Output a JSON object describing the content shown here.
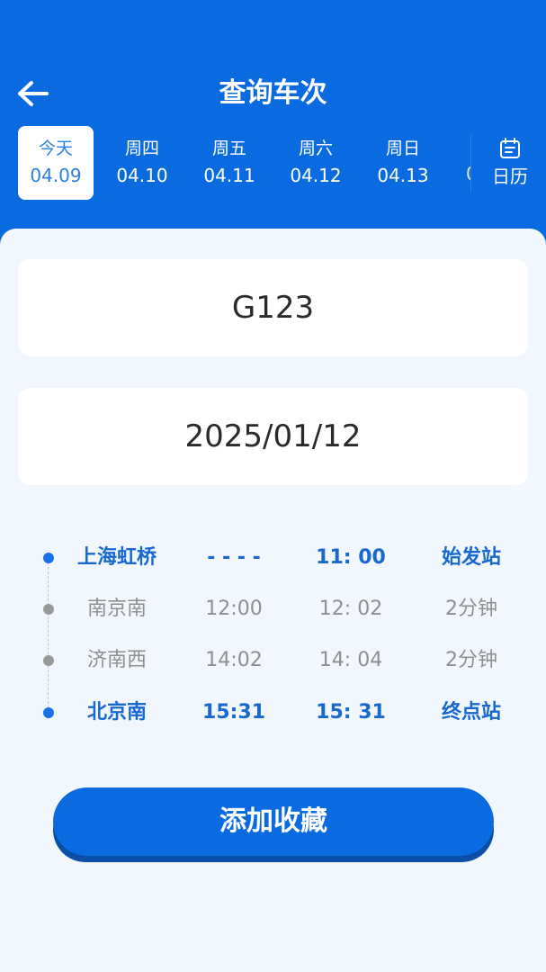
{
  "header": {
    "title": "查询车次",
    "back_icon": "arrow-left-icon",
    "background": "#0a6be0"
  },
  "date_tabs": [
    {
      "weekday": "今天",
      "date": "04.09",
      "active": true
    },
    {
      "weekday": "周四",
      "date": "04.10",
      "active": false
    },
    {
      "weekday": "周五",
      "date": "04.11",
      "active": false
    },
    {
      "weekday": "周六",
      "date": "04.12",
      "active": false
    },
    {
      "weekday": "周日",
      "date": "04.13",
      "active": false
    }
  ],
  "date_strip_clipped": "0",
  "calendar": {
    "label": "日历",
    "icon": "calendar-icon"
  },
  "train_number": {
    "value": "G123"
  },
  "travel_date": {
    "value": "2025/01/12"
  },
  "stops": [
    {
      "station": "上海虹桥",
      "arrive": "- - - -",
      "depart": "11: 00",
      "stay": "始发站",
      "highlight": true
    },
    {
      "station": "南京南",
      "arrive": "12:00",
      "depart": "12: 02",
      "stay": "2分钟",
      "highlight": false
    },
    {
      "station": "济南西",
      "arrive": "14:02",
      "depart": "14: 04",
      "stay": "2分钟",
      "highlight": false
    },
    {
      "station": "北京南",
      "arrive": "15:31",
      "depart": "15: 31",
      "stay": "终点站",
      "highlight": true
    }
  ],
  "favorite_button": {
    "label": "添加收藏"
  },
  "colors": {
    "accent": "#0a6be0",
    "highlight_text": "#1869cf",
    "muted_text": "#8f8f8f",
    "page_background": "#f1f7fd"
  }
}
